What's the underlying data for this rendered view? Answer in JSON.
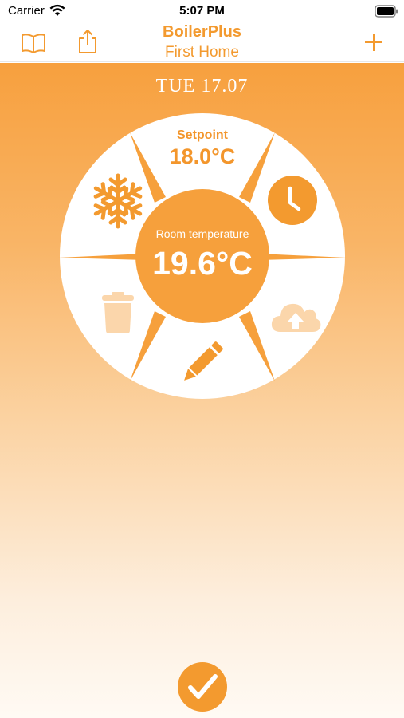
{
  "status_bar": {
    "carrier": "Carrier",
    "time": "5:07 PM"
  },
  "nav": {
    "title": "BoilerPlus",
    "subtitle": "First Home",
    "left_icons": [
      "book-icon",
      "share-icon"
    ],
    "right_icon": "plus-icon"
  },
  "main": {
    "date": "TUE  17.07"
  },
  "dial": {
    "setpoint_label": "Setpoint",
    "setpoint_value": "18.0°C",
    "room_label": "Room temperature",
    "room_value": "19.6°C",
    "actions": [
      "snowflake-icon",
      "clock-icon",
      "trash-icon",
      "cloud-upload-icon",
      "pencil-icon"
    ]
  },
  "confirm": {
    "icon": "checkmark-icon"
  },
  "colors": {
    "accent": "#f39a2f",
    "icon_faded": "#fbd6ab",
    "white": "#ffffff"
  }
}
